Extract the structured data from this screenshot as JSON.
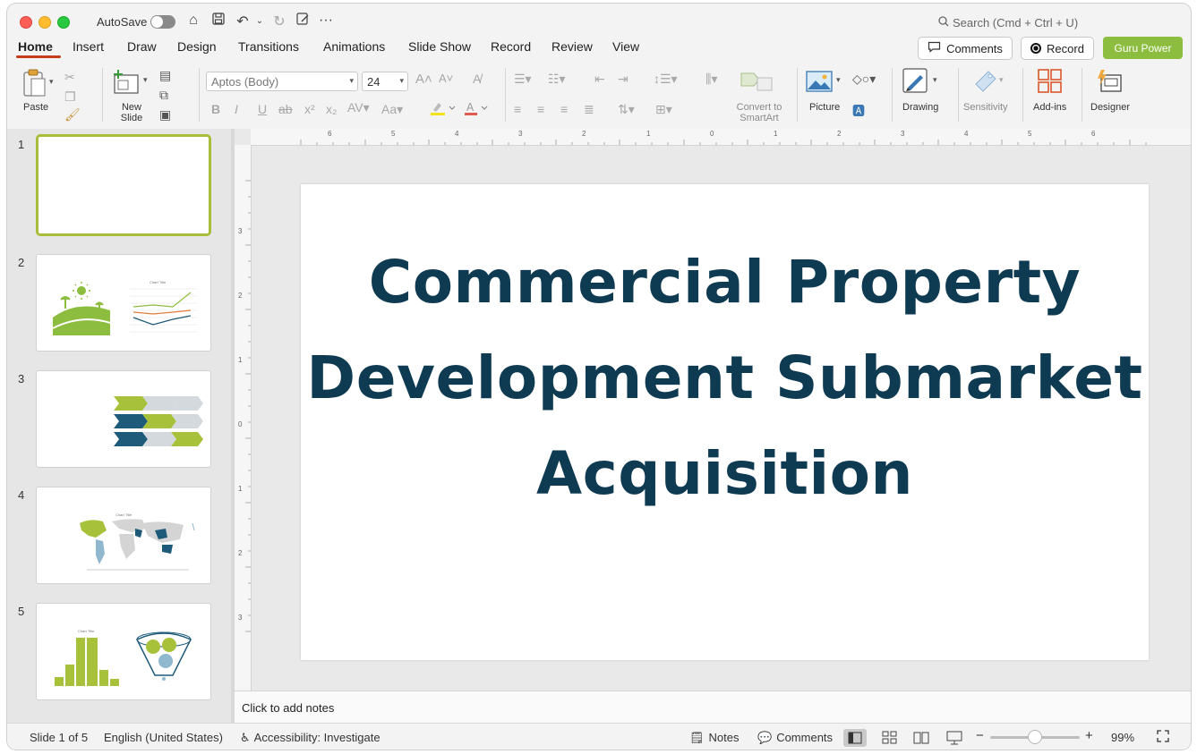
{
  "titlebar": {
    "autosave_label": "AutoSave",
    "search_placeholder": "Search (Cmd + Ctrl + U)"
  },
  "tabs": [
    {
      "label": "Home",
      "active": true
    },
    {
      "label": "Insert"
    },
    {
      "label": "Draw"
    },
    {
      "label": "Design"
    },
    {
      "label": "Transitions"
    },
    {
      "label": "Animations"
    },
    {
      "label": "Slide Show"
    },
    {
      "label": "Record"
    },
    {
      "label": "Review"
    },
    {
      "label": "View"
    }
  ],
  "header_buttons": {
    "comments": "Comments",
    "record": "Record",
    "guru": "Guru Power"
  },
  "ribbon": {
    "paste": "Paste",
    "new_slide": "New Slide",
    "font_name": "Aptos (Body)",
    "font_size": "24",
    "convert_smartart": "Convert to SmartArt",
    "picture": "Picture",
    "drawing": "Drawing",
    "sensitivity": "Sensitivity",
    "addins": "Add-ins",
    "designer": "Designer"
  },
  "thumbnails": [
    {
      "number": "1",
      "selected": true
    },
    {
      "number": "2",
      "chart_title": "Chart Title"
    },
    {
      "number": "3"
    },
    {
      "number": "4",
      "chart_title": "Chart Title"
    },
    {
      "number": "5",
      "chart_title": "Chart Title"
    }
  ],
  "slide": {
    "title": "Commercial Property Development Submarket Acquisition"
  },
  "ruler": {
    "h_ticks": [
      "6",
      "5",
      "4",
      "3",
      "2",
      "1",
      "0",
      "1",
      "2",
      "3",
      "4",
      "5",
      "6"
    ],
    "v_ticks": [
      "3",
      "2",
      "1",
      "0",
      "1",
      "2",
      "3"
    ]
  },
  "notes": {
    "placeholder": "Click to add notes"
  },
  "status": {
    "slide_info": "Slide 1 of 5",
    "language": "English (United States)",
    "accessibility": "Accessibility: Investigate",
    "notes": "Notes",
    "comments": "Comments",
    "zoom": "99%"
  },
  "colors": {
    "accent_tab": "#c43e1c",
    "title_color": "#0e3a52",
    "guru_green": "#8cbd3f",
    "thumb_border": "#a9bd3a"
  }
}
